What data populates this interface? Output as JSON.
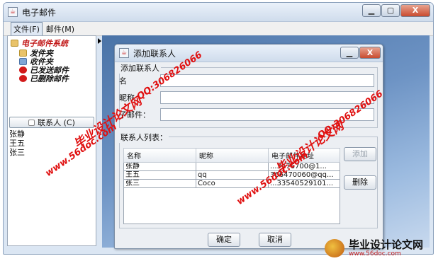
{
  "main_window": {
    "title": "电子邮件",
    "buttons": {
      "minimize": "▁",
      "maximize": "▢",
      "close": "X"
    }
  },
  "menu": {
    "items": [
      "文件(F)",
      "邮件(M)"
    ]
  },
  "tree": {
    "root": "电子邮件系统",
    "nodes": [
      "发件夹",
      "收件夹",
      "已发送邮件",
      "已删除邮件"
    ]
  },
  "contacts_button": "联系人 (C)",
  "contact_list": [
    "张静",
    "王五",
    "张三"
  ],
  "dialog": {
    "title": "添加联系人",
    "group1_title": "添加联系人",
    "fields": [
      {
        "label": "名",
        "value": ""
      },
      {
        "label": "昵称",
        "value": ""
      },
      {
        "label": "子邮件：",
        "value": ""
      }
    ],
    "group2_title": "联系人列表：",
    "table": {
      "headers": [
        "名称",
        "昵称",
        "电子邮件地址"
      ],
      "rows": [
        [
          "张静",
          "",
          "...3476700@1..."
        ],
        [
          "王五",
          "qq",
          "366470060@qq..."
        ],
        [
          "张三",
          "Coco",
          "...33540529101..."
        ]
      ]
    },
    "add_button": "添加",
    "delete_button": "删除",
    "ok_button": "确定",
    "cancel_button": "取消"
  },
  "watermarks": [
    "毕业设计论文网",
    "QQ:306826066",
    "www.56doc.com"
  ],
  "brand": {
    "title": "毕业设计论文网",
    "url": "www.56doc.com"
  },
  "colors": {
    "accent": "#c21a1a",
    "desktop": "#6d93c4"
  }
}
